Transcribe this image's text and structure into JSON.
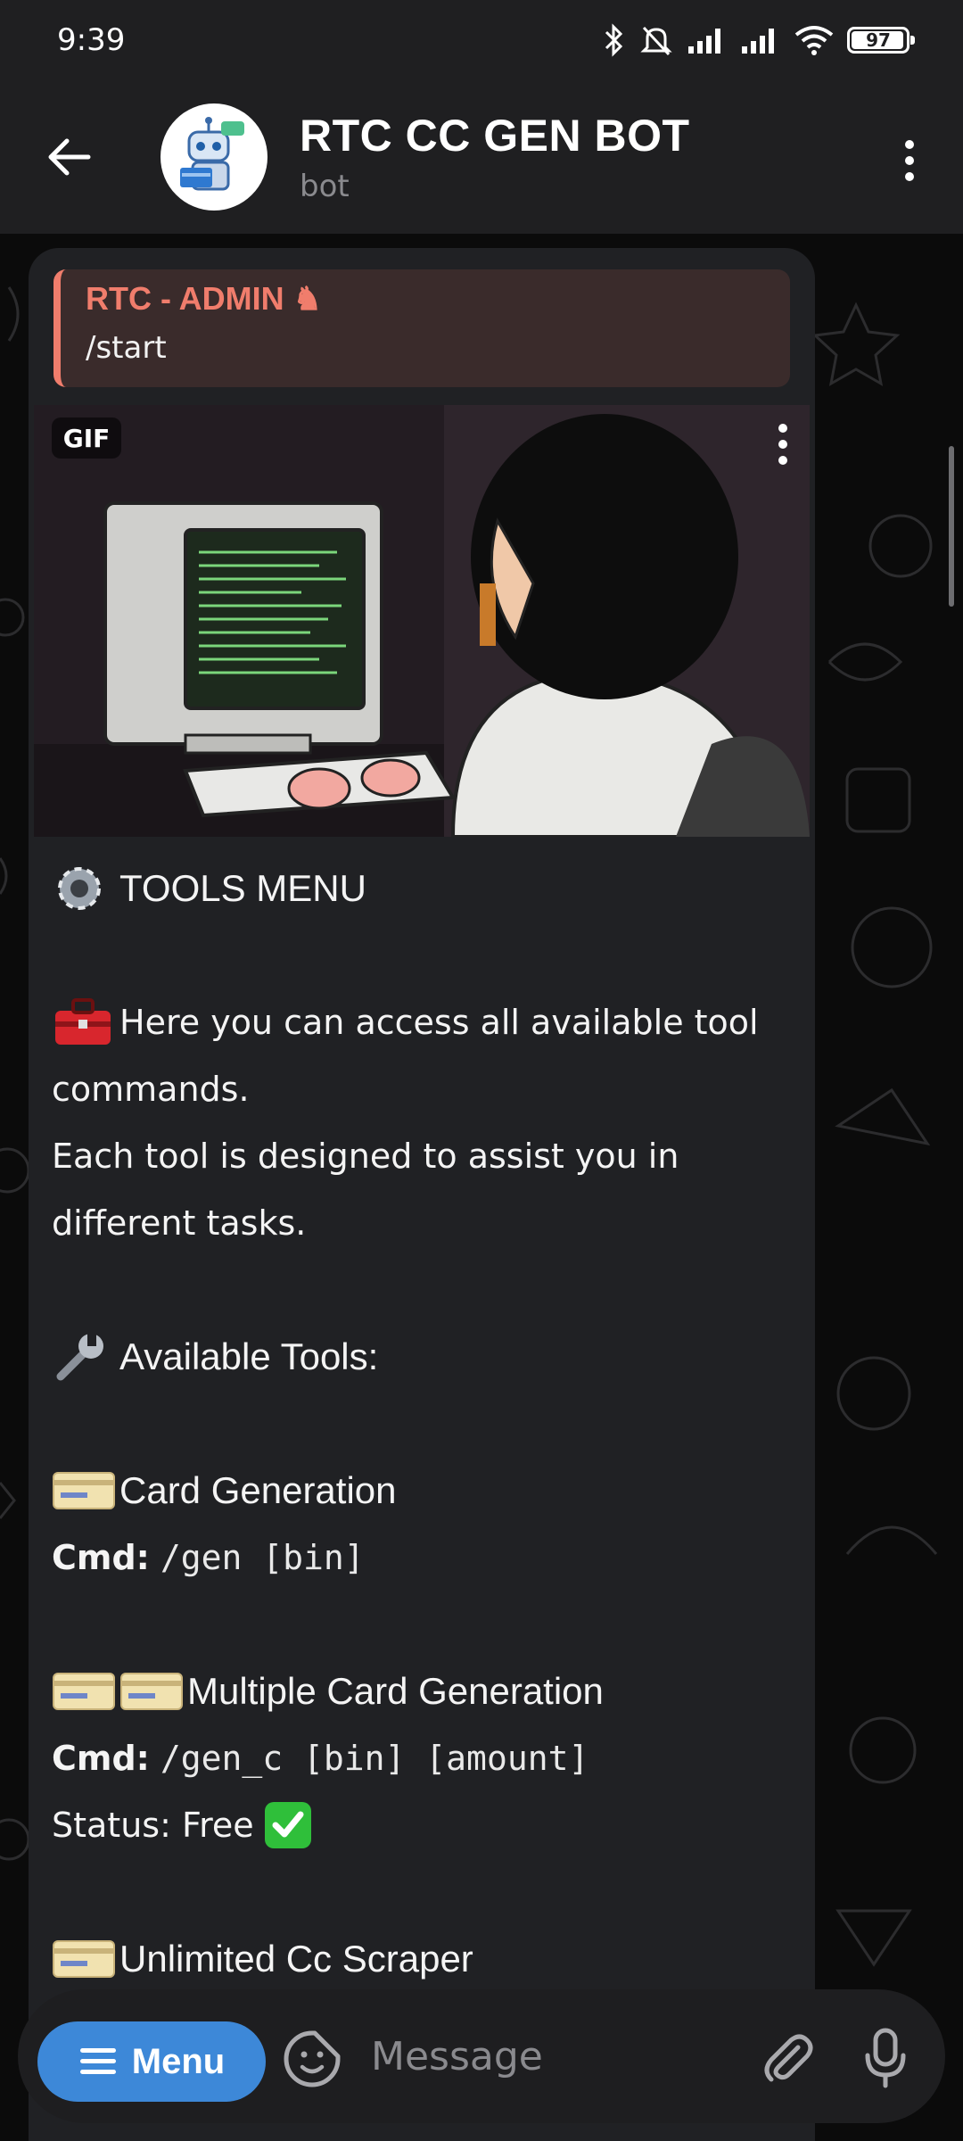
{
  "status_bar": {
    "time": "9:39",
    "battery": "97",
    "icons": [
      "bluetooth-icon",
      "bell-off-icon",
      "signal-icon",
      "signal-icon",
      "wifi-icon",
      "battery-icon"
    ]
  },
  "header": {
    "title": "RTC CC GEN BOT",
    "subtitle": "bot",
    "back_icon": "arrow-left-icon",
    "more_icon": "vertical-dots-icon"
  },
  "message": {
    "reply": {
      "author": "RTC - ADMIN ♞",
      "text": "/start"
    },
    "gif_badge": "GIF",
    "lines": {
      "tools_menu": "TOOLS MENU",
      "intro_1": "Here you can access all available tool",
      "intro_2": "commands.",
      "intro_3": "Each tool is designed to assist you in",
      "intro_4": "different tasks.",
      "available": "Available Tools:",
      "tool1_name": "Card Generation",
      "tool1_cmd_label": "Cmd:",
      "tool1_cmd": "/gen [bin]",
      "tool2_name": "Multiple Card Generation",
      "tool2_cmd_label": "Cmd:",
      "tool2_cmd": "/gen_c [bin] [amount]",
      "tool2_status": "Status: Free",
      "tool3_name": "Unlimited Cc Scraper"
    },
    "emojis": {
      "gear": "⚙️",
      "toolbox": "🧰",
      "wrench": "🔧",
      "card": "💳",
      "check": "✅"
    }
  },
  "input_bar": {
    "menu_label": "Menu",
    "placeholder": "Message"
  },
  "colors": {
    "accent_blue": "#3d88d8",
    "reply_accent": "#f07d6c",
    "bubble_bg": "#202124",
    "header_bg": "#1f1f21"
  }
}
